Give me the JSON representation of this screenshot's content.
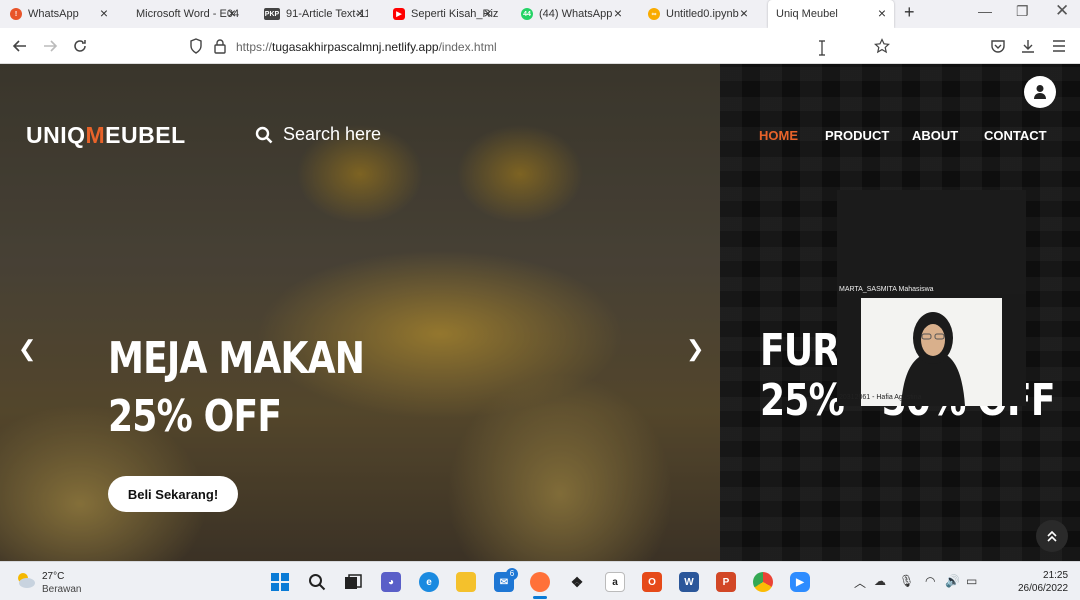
{
  "tabs": [
    {
      "title": "WhatsApp",
      "color": "#e8542a"
    },
    {
      "title": "Microsoft Word - E04",
      "color": "#ffffff"
    },
    {
      "title": "91-Article Text-11",
      "color": "#444444"
    },
    {
      "title": "Seperti Kisah_Rizk",
      "color": "#ff0000"
    },
    {
      "title": "(44) WhatsApp",
      "color": "#25d366"
    },
    {
      "title": "Untitled0.ipynb - ",
      "color": "#f9ab00"
    },
    {
      "title": "Uniq Meubel",
      "color": "#ffffff"
    }
  ],
  "tab_icons": {
    "pkp": "PKP",
    "whatsapp_num": "44"
  },
  "url": {
    "prefix": "https://",
    "host": "tugasakhirpascalmnj.netlify.app",
    "path": "/index.html"
  },
  "site": {
    "brand_a": "UNIQ",
    "brand_m": "M",
    "brand_b": "EUBEL",
    "search_placeholder": "Search here",
    "nav": [
      "HOME",
      "PRODUCT",
      "ABOUT",
      "CONTACT"
    ],
    "hero_line1": "MEJA MAKAN",
    "hero_line2": "25% OFF",
    "cta": "Beli Sekarang!",
    "next_line1": "FURI",
    "next_line2": "25% - 50% OFF",
    "accent": "#e8632a"
  },
  "video_call": {
    "name1": "MARTA_SASMITA Mahasiswa",
    "name2": "20312061 - Hafia Agustina"
  },
  "taskbar": {
    "temp": "27°C",
    "weather": "Berawan",
    "time": "21:25",
    "date": "26/06/2022",
    "mail_badge": "6"
  }
}
